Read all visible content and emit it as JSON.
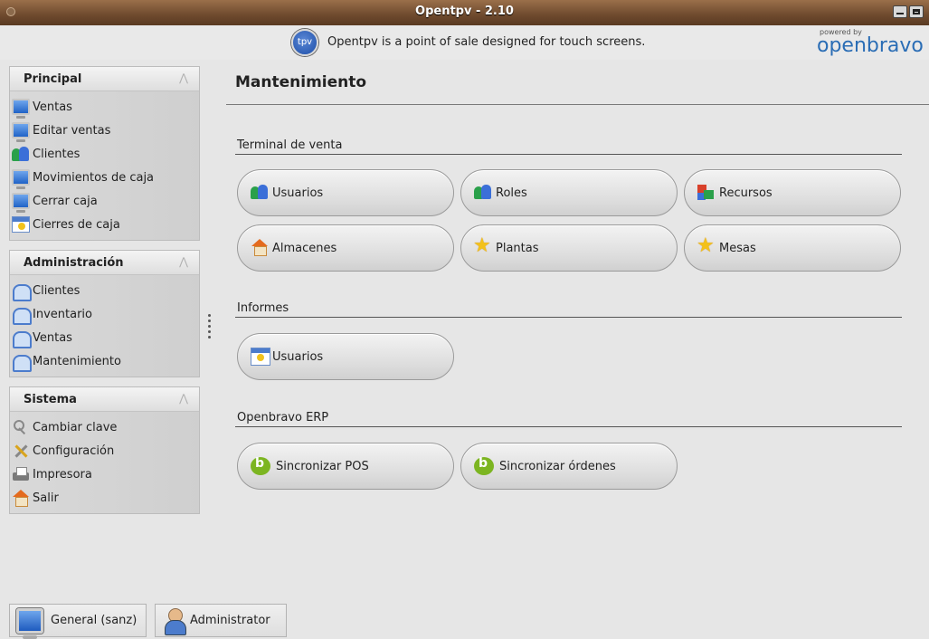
{
  "window": {
    "title": "Opentpv - 2.10"
  },
  "banner": {
    "logo_text": "tpv",
    "tagline": "Opentpv is a point of sale designed for touch screens.",
    "powered_by": "powered by",
    "brand": "openbravo"
  },
  "sidebar": {
    "panels": [
      {
        "title": "Principal",
        "items": [
          {
            "label": "Ventas",
            "icon": "monitor-icon"
          },
          {
            "label": "Editar ventas",
            "icon": "monitor-icon"
          },
          {
            "label": "Clientes",
            "icon": "users-icon"
          },
          {
            "label": "Movimientos de caja",
            "icon": "monitor-icon"
          },
          {
            "label": "Cerrar caja",
            "icon": "monitor-icon"
          },
          {
            "label": "Cierres de caja",
            "icon": "calendar-icon"
          }
        ]
      },
      {
        "title": "Administración",
        "items": [
          {
            "label": "Clientes",
            "icon": "book-icon"
          },
          {
            "label": "Inventario",
            "icon": "book-icon"
          },
          {
            "label": "Ventas",
            "icon": "book-icon"
          },
          {
            "label": "Mantenimiento",
            "icon": "book-icon"
          }
        ]
      },
      {
        "title": "Sistema",
        "items": [
          {
            "label": "Cambiar clave",
            "icon": "key-icon"
          },
          {
            "label": "Configuración",
            "icon": "tools-icon"
          },
          {
            "label": "Impresora",
            "icon": "printer-icon"
          },
          {
            "label": "Salir",
            "icon": "home-icon"
          }
        ]
      }
    ]
  },
  "main": {
    "title": "Mantenimiento",
    "sections": [
      {
        "label": "Terminal de venta",
        "buttons": [
          "Usuarios",
          "Roles",
          "Recursos",
          "Almacenes",
          "Plantas",
          "Mesas"
        ]
      },
      {
        "label": "Informes",
        "buttons": [
          "Usuarios"
        ]
      },
      {
        "label": "Openbravo ERP",
        "buttons": [
          "Sincronizar POS",
          "Sincronizar órdenes"
        ]
      }
    ]
  },
  "statusbar": {
    "host": "General (sanz)",
    "user": "Administrator"
  }
}
